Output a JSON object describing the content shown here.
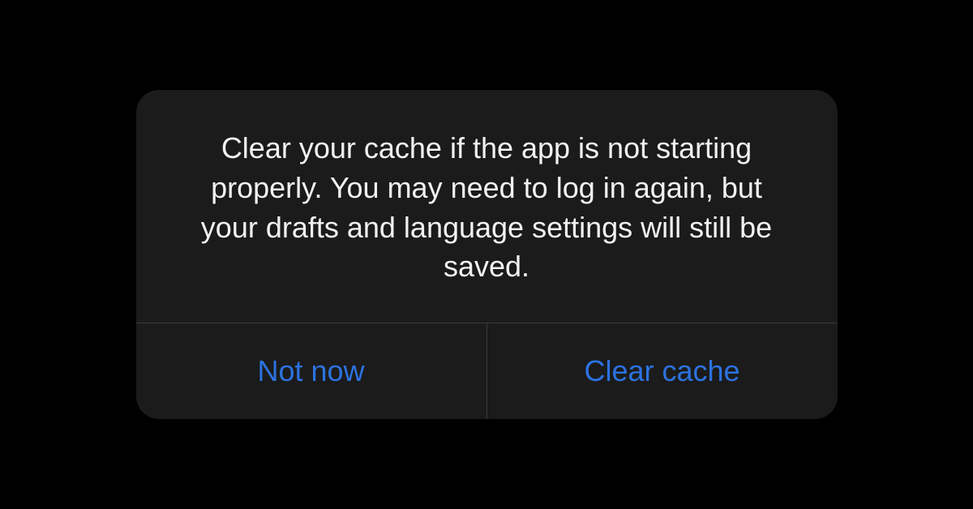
{
  "dialog": {
    "message": "Clear your cache if the app is not starting properly. You may need to log in again, but your drafts and language settings will still be saved.",
    "actions": {
      "cancel_label": "Not now",
      "confirm_label": "Clear cache"
    }
  }
}
